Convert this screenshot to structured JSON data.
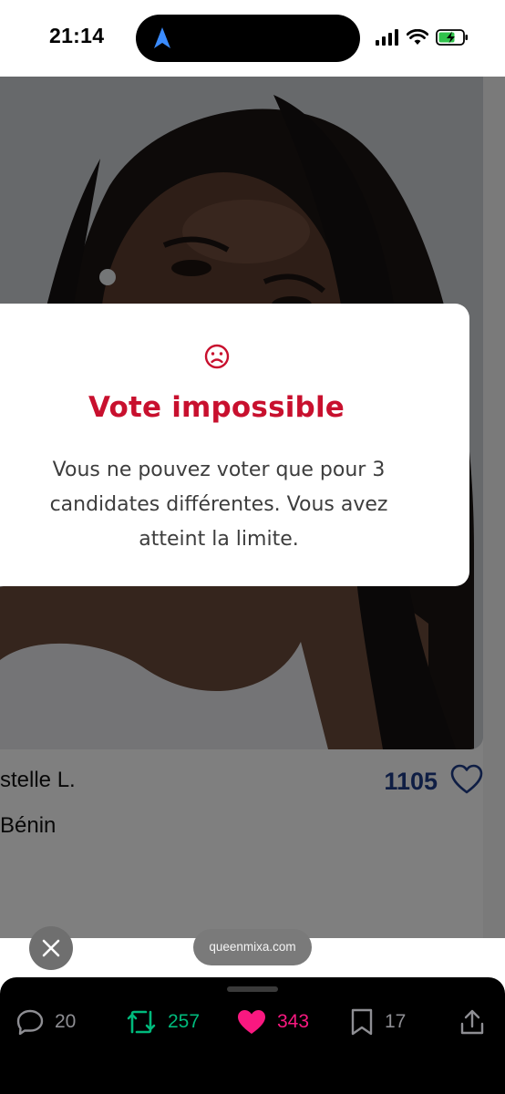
{
  "status_bar": {
    "time": "21:14"
  },
  "candidate": {
    "name": "stelle L.",
    "country": "Bénin",
    "votes": "1105"
  },
  "dialog": {
    "icon": "frown-icon",
    "title": "Vote impossible",
    "message": "Vous ne pouvez voter que pour 3 candidates différentes. Vous avez atteint la limite."
  },
  "browser": {
    "url": "queenmixa.com"
  },
  "actions": {
    "replies": "20",
    "reposts": "257",
    "likes": "343",
    "bookmarks": "17"
  },
  "colors": {
    "title_red": "#c8102e",
    "vote_blue": "#1f3c88",
    "repost_green": "#00ba7c",
    "like_pink": "#f91880"
  }
}
